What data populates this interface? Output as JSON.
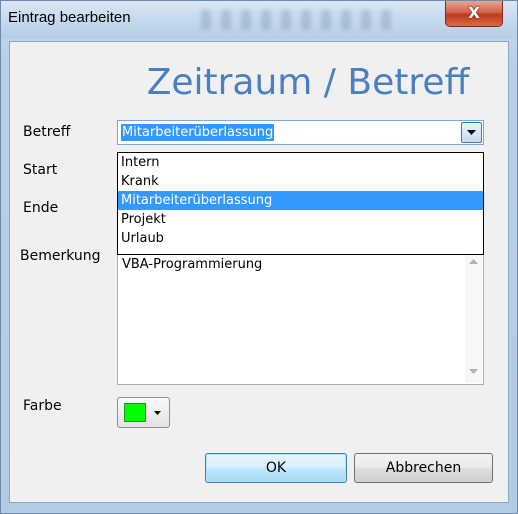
{
  "window": {
    "title": "Eintrag bearbeiten",
    "close_glyph": "X"
  },
  "form": {
    "heading": "Zeitraum / Betreff",
    "labels": {
      "betreff": "Betreff",
      "start": "Start",
      "ende": "Ende",
      "bemerkung": "Bemerkung",
      "farbe": "Farbe"
    },
    "betreff_value": "Mitarbeiterüberlassung",
    "betreff_options": [
      "Intern",
      "Krank",
      "Mitarbeiterüberlassung",
      "Projekt",
      "Urlaub"
    ],
    "betreff_selected_index": 2,
    "bemerkung_value": "VBA-Programmierung",
    "farbe_color": "#00ff00"
  },
  "buttons": {
    "ok": "OK",
    "cancel": "Abbrechen"
  },
  "colors": {
    "heading": "#4a7fc1",
    "selection": "#3399ff"
  }
}
